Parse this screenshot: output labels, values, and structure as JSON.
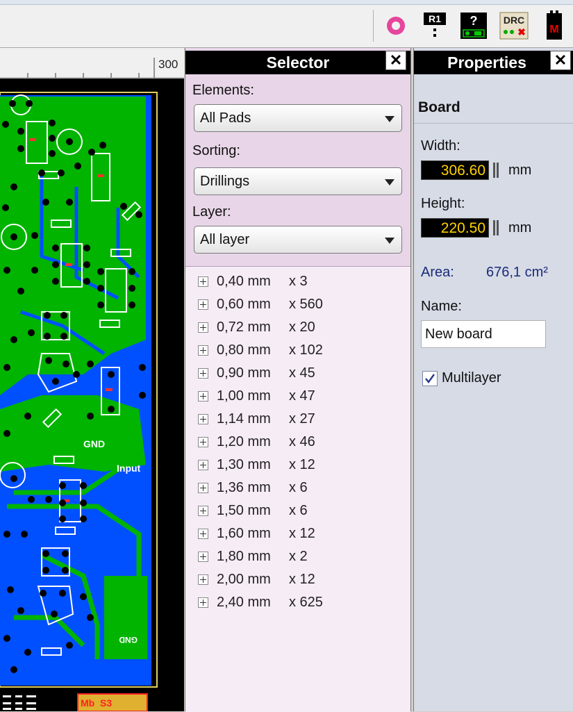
{
  "toolbar": {
    "buttons": [
      {
        "name": "drill-hole-icon",
        "text": ""
      },
      {
        "name": "r1-icon",
        "text": "R1"
      },
      {
        "name": "help-icon",
        "text": "?"
      },
      {
        "name": "drc-icon",
        "text": "DRC"
      },
      {
        "name": "macro-icon",
        "text": "M"
      }
    ]
  },
  "ruler": {
    "label": "300"
  },
  "board_labels": {
    "gnd1": "GND",
    "input": "Input",
    "gnd2": "GND",
    "bottom_text": "S3",
    "bottom_badge": "Mb"
  },
  "selector": {
    "title": "Selector",
    "close": "✕",
    "elements_label": "Elements:",
    "elements_value": "All Pads",
    "sorting_label": "Sorting:",
    "sorting_value": "Drillings",
    "layer_label": "Layer:",
    "layer_value": "All layer",
    "items": [
      {
        "size": "0,40 mm",
        "count": "x 3"
      },
      {
        "size": "0,60 mm",
        "count": "x 560"
      },
      {
        "size": "0,72 mm",
        "count": "x 20"
      },
      {
        "size": "0,80 mm",
        "count": "x 102"
      },
      {
        "size": "0,90 mm",
        "count": "x 45"
      },
      {
        "size": "1,00 mm",
        "count": "x 47"
      },
      {
        "size": "1,14 mm",
        "count": "x 27"
      },
      {
        "size": "1,20 mm",
        "count": "x 46"
      },
      {
        "size": "1,30 mm",
        "count": "x 12"
      },
      {
        "size": "1,36 mm",
        "count": "x 6"
      },
      {
        "size": "1,50 mm",
        "count": "x 6"
      },
      {
        "size": "1,60 mm",
        "count": "x 12"
      },
      {
        "size": "1,80 mm",
        "count": "x 2"
      },
      {
        "size": "2,00 mm",
        "count": "x 12"
      },
      {
        "size": "2,40 mm",
        "count": "x 625"
      }
    ]
  },
  "properties": {
    "title": "Properties",
    "close": "✕",
    "section": "Board",
    "width_label": "Width:",
    "width_value": "306.60",
    "height_label": "Height:",
    "height_value": "220.50",
    "unit": "mm",
    "area_label": "Area:",
    "area_value": "676,1 cm²",
    "name_label": "Name:",
    "name_value": "New board",
    "multilayer_label": "Multilayer",
    "multilayer_checked": true
  },
  "colors": {
    "board_fill": "#00b400",
    "board_bg": "#0050ff",
    "silkscreen": "#ffffff",
    "value_text": "#ffd200",
    "selector_bg": "#e8d6e8",
    "properties_bg": "#d6dbe6"
  }
}
